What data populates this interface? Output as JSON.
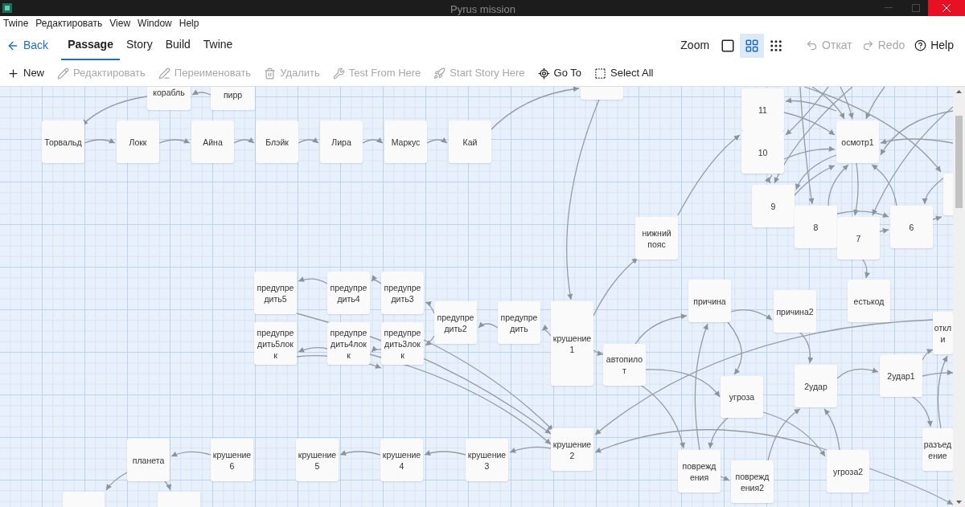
{
  "window": {
    "title": "Pyrus mission"
  },
  "menu": [
    "Twine",
    "Редактировать",
    "View",
    "Window",
    "Help"
  ],
  "nav": {
    "back": "Back",
    "tabs": [
      {
        "label": "Passage",
        "selected": true
      },
      {
        "label": "Story",
        "selected": false
      },
      {
        "label": "Build",
        "selected": false
      },
      {
        "label": "Twine",
        "selected": false
      }
    ]
  },
  "zoom": {
    "label": "Zoom",
    "levels": [
      {
        "kind": "single",
        "selected": false
      },
      {
        "kind": "grid",
        "selected": true
      },
      {
        "kind": "dense",
        "selected": false
      }
    ]
  },
  "history": [
    {
      "kind": "undo",
      "label": "Откат",
      "disabled": true
    },
    {
      "kind": "redo",
      "label": "Redo",
      "disabled": true
    },
    {
      "kind": "help",
      "label": "Help",
      "disabled": false
    }
  ],
  "toolbar": [
    {
      "kind": "new",
      "label": "New",
      "disabled": false
    },
    {
      "kind": "edit",
      "label": "Редактировать",
      "disabled": true
    },
    {
      "kind": "rename",
      "label": "Переименовать",
      "disabled": true
    },
    {
      "kind": "delete",
      "label": "Удалить",
      "disabled": true
    },
    {
      "kind": "test",
      "label": "Test From Here",
      "disabled": true
    },
    {
      "kind": "start",
      "label": "Start Story Here",
      "disabled": true
    },
    {
      "kind": "goto",
      "label": "Go To",
      "disabled": false
    },
    {
      "kind": "select",
      "label": "Select All",
      "disabled": false
    }
  ],
  "passages": [
    {
      "lines": [
        "корабль"
      ]
    },
    {
      "lines": [
        "пирр"
      ]
    },
    {
      "lines": [
        "11"
      ]
    },
    {
      "lines": [
        "Торвальд"
      ]
    },
    {
      "lines": [
        "Локк"
      ]
    },
    {
      "lines": [
        "Айна"
      ]
    },
    {
      "lines": [
        "Блэйк"
      ]
    },
    {
      "lines": [
        "Лира"
      ]
    },
    {
      "lines": [
        "Маркус"
      ]
    },
    {
      "lines": [
        "Кай"
      ]
    },
    {
      "lines": [
        "осмотр1"
      ]
    },
    {
      "lines": [
        "10"
      ]
    },
    {
      "lines": [
        "9"
      ]
    },
    {
      "lines": [
        "8"
      ]
    },
    {
      "lines": [
        "6"
      ]
    },
    {
      "lines": [
        "7"
      ]
    },
    {
      "lines": [
        "нижний",
        "пояс"
      ]
    },
    {
      "lines": [
        "предупре",
        "дить5"
      ]
    },
    {
      "lines": [
        "предупре",
        "дить4"
      ]
    },
    {
      "lines": [
        "предупре",
        "дить3"
      ]
    },
    {
      "lines": [
        "причина"
      ]
    },
    {
      "lines": [
        "естькод"
      ]
    },
    {
      "lines": [
        "причина2"
      ]
    },
    {
      "lines": [
        "предупре",
        "дить5лок",
        "к"
      ]
    },
    {
      "lines": [
        "предупре",
        "дить4лок",
        "к"
      ]
    },
    {
      "lines": [
        "предупре",
        "дить3лок",
        "к"
      ]
    },
    {
      "lines": [
        "предупре",
        "дить2"
      ]
    },
    {
      "lines": [
        "предупре",
        "дить"
      ]
    },
    {
      "lines": [
        "крушение",
        "1"
      ]
    },
    {
      "lines": [
        "откл",
        "и"
      ]
    },
    {
      "lines": [
        "автопило",
        "т"
      ]
    },
    {
      "lines": [
        "2удар1"
      ]
    },
    {
      "lines": [
        "2удар"
      ]
    },
    {
      "lines": [
        "угроза"
      ]
    },
    {
      "lines": [
        "крушение",
        "2"
      ]
    },
    {
      "lines": [
        "разъед",
        "ение"
      ]
    },
    {
      "lines": [
        "поврежд",
        "ения"
      ]
    },
    {
      "lines": [
        "угроза2"
      ]
    },
    {
      "lines": [
        "поврежд",
        "ения2"
      ]
    },
    {
      "lines": [
        "планета"
      ]
    },
    {
      "lines": [
        "крушение",
        "6"
      ]
    },
    {
      "lines": [
        "крушение",
        "5"
      ]
    },
    {
      "lines": [
        "крушение",
        "4"
      ]
    },
    {
      "lines": [
        "крушение",
        "3"
      ]
    }
  ]
}
